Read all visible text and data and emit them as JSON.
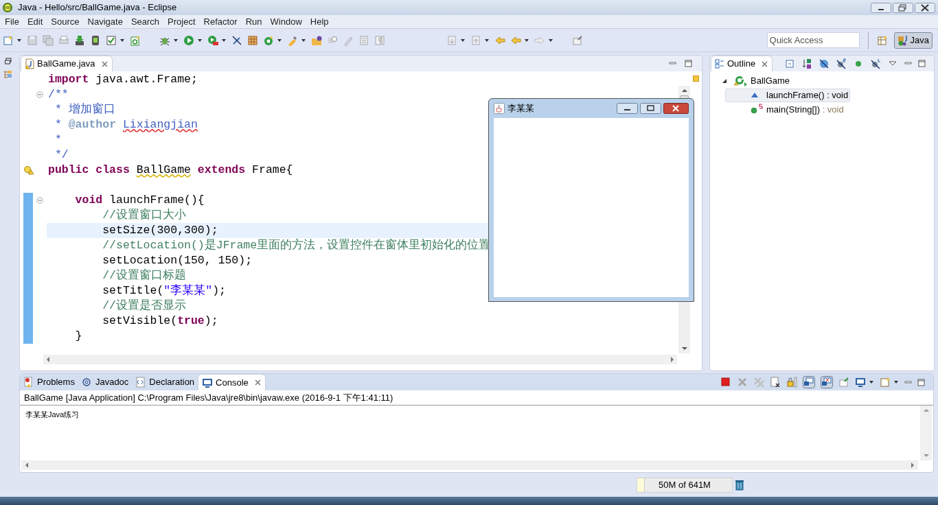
{
  "window": {
    "title": "Java - Hello/src/BallGame.java - Eclipse"
  },
  "menu": [
    "File",
    "Edit",
    "Source",
    "Navigate",
    "Search",
    "Project",
    "Refactor",
    "Run",
    "Window",
    "Help"
  ],
  "quick_access": {
    "placeholder": "Quick Access"
  },
  "perspective": {
    "label": "Java",
    "selected": true
  },
  "editor": {
    "tab": "BallGame.java",
    "lines": [
      {
        "fold": false,
        "current": false,
        "warning": false,
        "changed": false,
        "segments": [
          {
            "kind": "keyword",
            "text": "import "
          },
          {
            "kind": "plain",
            "text": "java.awt.Frame;"
          }
        ]
      },
      {
        "fold": true,
        "current": false,
        "warning": false,
        "changed": false,
        "segments": [
          {
            "kind": "javadoc",
            "text": "/**"
          }
        ]
      },
      {
        "fold": false,
        "current": false,
        "warning": false,
        "changed": false,
        "segments": [
          {
            "kind": "javadoc",
            "text": " * 增加窗口"
          }
        ]
      },
      {
        "fold": false,
        "current": false,
        "warning": false,
        "changed": false,
        "segments": [
          {
            "kind": "javadoc",
            "text": " * "
          },
          {
            "kind": "javadoc_tag",
            "text": "@author "
          },
          {
            "kind": "javadoc_spell",
            "text": "Lixiangjian"
          }
        ]
      },
      {
        "fold": false,
        "current": false,
        "warning": false,
        "changed": false,
        "segments": [
          {
            "kind": "javadoc",
            "text": " *"
          }
        ]
      },
      {
        "fold": false,
        "current": false,
        "warning": false,
        "changed": false,
        "segments": [
          {
            "kind": "javadoc",
            "text": " */"
          }
        ]
      },
      {
        "fold": false,
        "current": false,
        "warning": true,
        "changed": false,
        "segments": [
          {
            "kind": "keyword",
            "text": "public class "
          },
          {
            "kind": "class_warn",
            "text": "BallGame"
          },
          {
            "kind": "keyword",
            "text": " extends "
          },
          {
            "kind": "plain",
            "text": "Frame{"
          }
        ]
      },
      {
        "fold": false,
        "current": false,
        "warning": false,
        "changed": false
      },
      {
        "fold": true,
        "current": false,
        "warning": false,
        "changed": true,
        "segments": [
          {
            "kind": "keyword",
            "text": "    void "
          },
          {
            "kind": "plain",
            "text": "launchFrame(){"
          }
        ]
      },
      {
        "fold": false,
        "current": false,
        "warning": false,
        "changed": true,
        "segments": [
          {
            "kind": "comment",
            "text": "        //设置窗口大小"
          }
        ]
      },
      {
        "fold": false,
        "current": true,
        "warning": false,
        "changed": true,
        "segments": [
          {
            "kind": "plain",
            "text": "        setSize(300,300);"
          }
        ]
      },
      {
        "fold": false,
        "current": false,
        "warning": false,
        "changed": true,
        "segments": [
          {
            "kind": "comment",
            "text": "        //setLocation()是JFrame里面的方法，设置控件在窗体里初始化的位置"
          }
        ]
      },
      {
        "fold": false,
        "current": false,
        "warning": false,
        "changed": true,
        "segments": [
          {
            "kind": "plain",
            "text": "        setLocation(150, 150);"
          }
        ]
      },
      {
        "fold": false,
        "current": false,
        "warning": false,
        "changed": true,
        "segments": [
          {
            "kind": "comment",
            "text": "        //设置窗口标题"
          }
        ]
      },
      {
        "fold": false,
        "current": false,
        "warning": false,
        "changed": true,
        "segments": [
          {
            "kind": "plain",
            "text": "        setTitle("
          },
          {
            "kind": "string",
            "text": "\"李某某\""
          },
          {
            "kind": "plain",
            "text": ");"
          }
        ]
      },
      {
        "fold": false,
        "current": false,
        "warning": false,
        "changed": true,
        "segments": [
          {
            "kind": "comment",
            "text": "        //设置是否显示"
          }
        ]
      },
      {
        "fold": false,
        "current": false,
        "warning": false,
        "changed": true,
        "segments": [
          {
            "kind": "plain",
            "text": "        setVisible("
          },
          {
            "kind": "keyword",
            "text": "true"
          },
          {
            "kind": "plain",
            "text": ");"
          }
        ]
      },
      {
        "fold": false,
        "current": false,
        "warning": false,
        "changed": true,
        "segments": [
          {
            "kind": "plain",
            "text": "    }"
          }
        ]
      }
    ]
  },
  "outline": {
    "tab": "Outline",
    "tree": [
      {
        "name": "BallGame",
        "kind": "class",
        "expanded": true,
        "selected": false,
        "children": [
          {
            "name": "launchFrame()",
            "type": " : void",
            "kind": "method_default",
            "static": false,
            "selected": true
          },
          {
            "name": "main(String[])",
            "type": " : void",
            "kind": "method_public",
            "static": true,
            "selected": false
          }
        ]
      }
    ]
  },
  "swing_window": {
    "title": "李某某"
  },
  "bottom": {
    "tabs": [
      {
        "label": "Problems",
        "selected": false
      },
      {
        "label": "Javadoc",
        "selected": false
      },
      {
        "label": "Declaration",
        "selected": false
      },
      {
        "label": "Console",
        "selected": true
      }
    ],
    "console_header": "BallGame [Java Application] C:\\Program Files\\Java\\jre8\\bin\\javaw.exe (2016-9-1 下午1:41:11)",
    "output": "李某某Java练习"
  },
  "status_bar": {
    "heap": "50M of 641M",
    "level": 0.08
  }
}
